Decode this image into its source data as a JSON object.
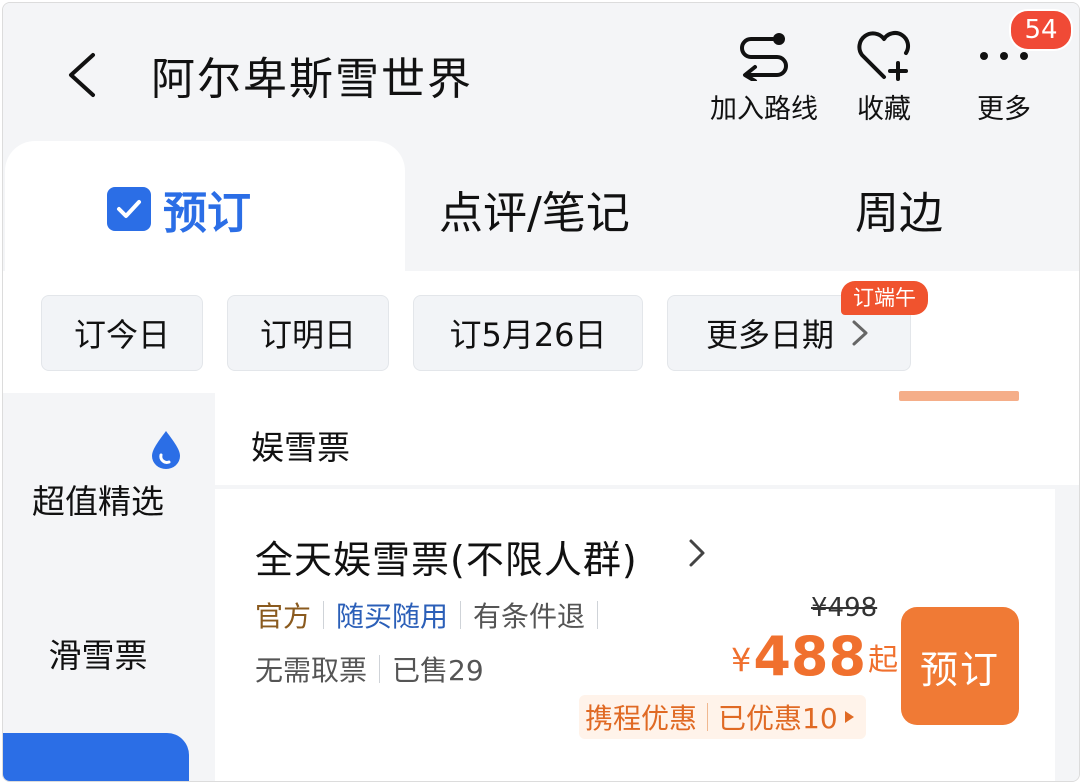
{
  "header": {
    "title": "阿尔卑斯雪世界",
    "actions": [
      {
        "label": "加入路线",
        "icon": "route-icon"
      },
      {
        "label": "收藏",
        "icon": "heart-plus-icon"
      },
      {
        "label": "更多",
        "icon": "more-dots-icon"
      }
    ],
    "badge": "54"
  },
  "tabs": {
    "active": "预订",
    "items": [
      "点评/笔记",
      "周边"
    ]
  },
  "dates": {
    "items": [
      "订今日",
      "订明日",
      "订5月26日",
      "更多日期"
    ],
    "promo": "订端午"
  },
  "sidebar": {
    "items": [
      "超值精选",
      "滑雪票"
    ]
  },
  "section": {
    "title": "娱雪票"
  },
  "product": {
    "title": "全天娱雪票(不限人群)",
    "tags": [
      {
        "text": "官方",
        "color": "#8a5a1e"
      },
      {
        "text": "随买随用",
        "color": "#2b5fb8"
      },
      {
        "text": "有条件退",
        "color": "#555555"
      }
    ],
    "row2": [
      "无需取票",
      "已售29"
    ],
    "original_price": "¥498",
    "currency": "¥",
    "price": "488",
    "price_suffix": "起",
    "deal_label": "携程优惠",
    "deal_value": "已优惠10",
    "book_label": "预订"
  },
  "colors": {
    "accent": "#2b6ee6",
    "price": "#f0702e",
    "badge": "#f04a36"
  }
}
